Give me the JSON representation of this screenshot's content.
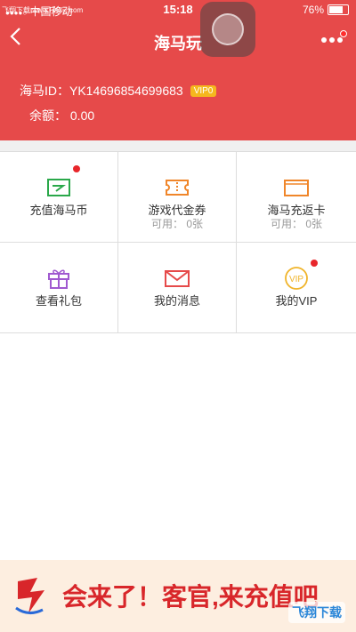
{
  "status_bar": {
    "carrier": "中国移动",
    "time": "15:18",
    "battery": "76%",
    "watermark": "飞翔下载 www.FXXZ.com"
  },
  "nav": {
    "title": "海马玩",
    "back_icon": "chevron-left-icon",
    "more_icon": "more-dots-icon"
  },
  "account": {
    "id_label": "海马ID：",
    "id_value": "YK14696854699683",
    "vip_level": "VIP0",
    "balance_label": "余额：",
    "balance_value": "0.00"
  },
  "grid": [
    {
      "label": "充值海马币",
      "sub": "",
      "icon": "recharge-card-icon",
      "color": "#2aa84a",
      "dot": true
    },
    {
      "label": "游戏代金券",
      "sub": "可用： 0张",
      "icon": "coupon-icon",
      "color": "#f0862a",
      "dot": false
    },
    {
      "label": "海马充返卡",
      "sub": "可用： 0张",
      "icon": "refund-card-icon",
      "color": "#f0862a",
      "dot": false
    },
    {
      "label": "查看礼包",
      "sub": "",
      "icon": "gift-icon",
      "color": "#a05ad0",
      "dot": false
    },
    {
      "label": "我的消息",
      "sub": "",
      "icon": "envelope-icon",
      "color": "#e64a4a",
      "dot": false
    },
    {
      "label": "我的VIP",
      "sub": "",
      "icon": "vip-icon",
      "color": "#f0b42a",
      "dot": true
    }
  ],
  "banner": {
    "text": "会来了！客官,来充值吧",
    "watermark": "飞翔下载"
  },
  "colors": {
    "primary": "#e64a4a",
    "badge": "#f5b81e",
    "dot": "#e8262b"
  }
}
